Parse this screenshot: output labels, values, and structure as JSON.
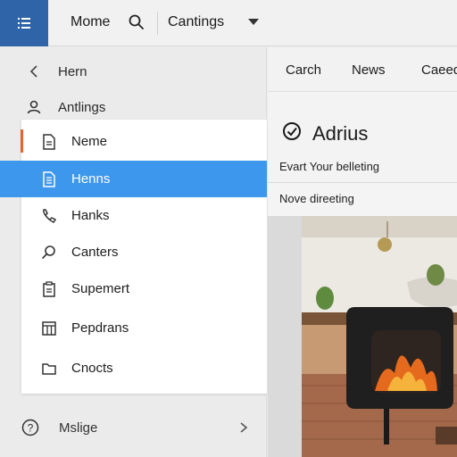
{
  "topbar": {
    "title": "Mome",
    "select_value": "Cantings",
    "menu_icon": "hamburger-icon",
    "accent": "#2f65a8"
  },
  "sidebar": {
    "back_label": "Hern",
    "settings_label": "Antlings",
    "footer_label": "Mslige"
  },
  "panel": {
    "items": [
      {
        "label": "Neme",
        "icon": "document-icon"
      },
      {
        "label": "Henns",
        "icon": "document-list-icon",
        "active": true
      },
      {
        "label": "Hanks",
        "icon": "phone-icon"
      },
      {
        "label": "Canters",
        "icon": "search-icon"
      },
      {
        "label": "Supemert",
        "icon": "clipboard-icon"
      },
      {
        "label": "Pepdrans",
        "icon": "table-icon"
      },
      {
        "label": "Cnocts",
        "icon": "folder-icon"
      }
    ],
    "active_color": "#3d97ec",
    "accent_color": "#e8642a"
  },
  "content": {
    "tabs": [
      "Carch",
      "News",
      "Caeed"
    ],
    "card_title": "Adrius",
    "card_subtitle": "Evart Your belleting",
    "card_footer": "Nove direeting"
  }
}
